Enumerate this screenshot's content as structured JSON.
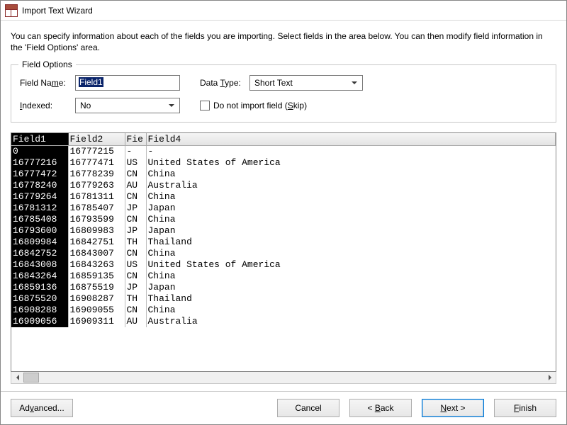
{
  "window": {
    "title": "Import Text Wizard"
  },
  "intro": "You can specify information about each of the fields you are importing. Select fields in the area below. You can then modify field information in the 'Field Options' area.",
  "fieldset": {
    "legend": "Field Options",
    "fieldName_label_pre": "Field Na",
    "fieldName_label_key": "m",
    "fieldName_label_post": "e:",
    "fieldName_value": "Field1",
    "indexed_label_pre": "",
    "indexed_label_key": "I",
    "indexed_label_post": "ndexed:",
    "indexed_value": "No",
    "dataType_label_pre": "Data ",
    "dataType_label_key": "T",
    "dataType_label_post": "ype:",
    "dataType_value": "Short Text",
    "skip_label_pre": "Do not import field (",
    "skip_label_key": "S",
    "skip_label_post": "kip)"
  },
  "preview": {
    "headers": [
      "Field1",
      "Field2",
      "Fie",
      "Field4"
    ],
    "rows": [
      [
        "0",
        "16777215",
        "-",
        "-"
      ],
      [
        "16777216",
        "16777471",
        "US",
        "United States of America"
      ],
      [
        "16777472",
        "16778239",
        "CN",
        "China"
      ],
      [
        "16778240",
        "16779263",
        "AU",
        "Australia"
      ],
      [
        "16779264",
        "16781311",
        "CN",
        "China"
      ],
      [
        "16781312",
        "16785407",
        "JP",
        "Japan"
      ],
      [
        "16785408",
        "16793599",
        "CN",
        "China"
      ],
      [
        "16793600",
        "16809983",
        "JP",
        "Japan"
      ],
      [
        "16809984",
        "16842751",
        "TH",
        "Thailand"
      ],
      [
        "16842752",
        "16843007",
        "CN",
        "China"
      ],
      [
        "16843008",
        "16843263",
        "US",
        "United States of America"
      ],
      [
        "16843264",
        "16859135",
        "CN",
        "China"
      ],
      [
        "16859136",
        "16875519",
        "JP",
        "Japan"
      ],
      [
        "16875520",
        "16908287",
        "TH",
        "Thailand"
      ],
      [
        "16908288",
        "16909055",
        "CN",
        "China"
      ],
      [
        "16909056",
        "16909311",
        "AU",
        "Australia"
      ]
    ]
  },
  "buttons": {
    "advanced_pre": "Ad",
    "advanced_key": "v",
    "advanced_post": "anced...",
    "cancel": "Cancel",
    "back_pre": "< ",
    "back_key": "B",
    "back_post": "ack",
    "next_pre": "",
    "next_key": "N",
    "next_post": "ext >",
    "finish_pre": "",
    "finish_key": "F",
    "finish_post": "inish"
  }
}
